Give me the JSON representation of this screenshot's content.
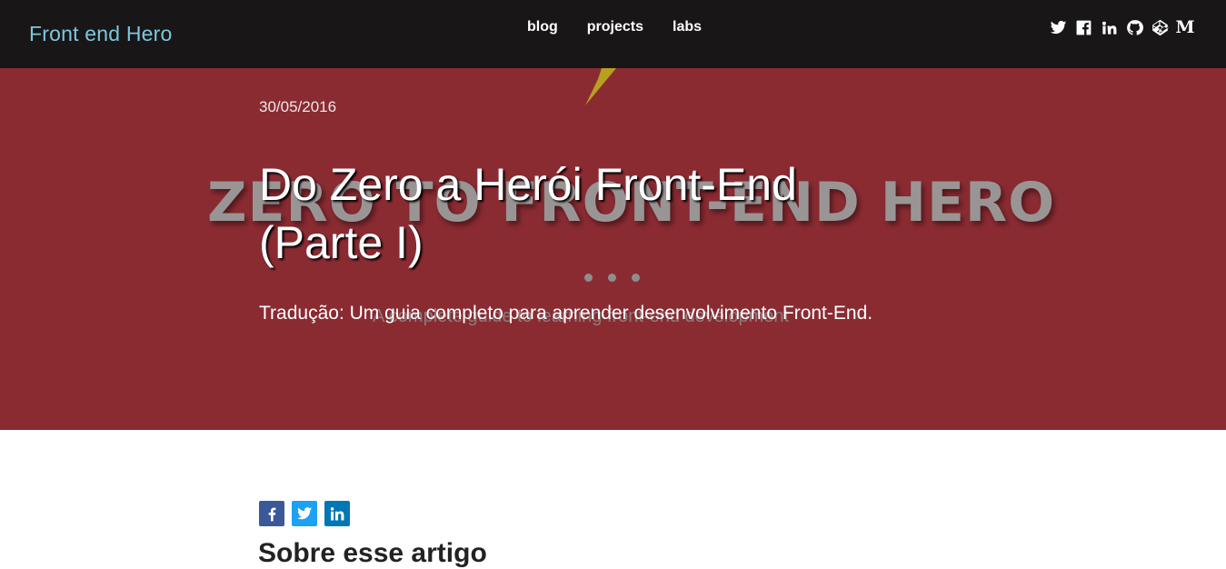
{
  "site": {
    "brand": "Front end Hero"
  },
  "nav": {
    "items": [
      {
        "label": "blog"
      },
      {
        "label": "projects"
      },
      {
        "label": "labs"
      }
    ]
  },
  "social": {
    "icons": [
      "twitter-icon",
      "facebook-icon",
      "linkedin-icon",
      "github-icon",
      "codepen-icon",
      "medium-icon"
    ],
    "medium_letter": "M"
  },
  "hero": {
    "background_color": "#8a2b32",
    "image_text": "ZERO TO FRONT-END HERO",
    "image_subtext": "A complete guide to learning front-end development",
    "date": "30/05/2016",
    "title": "Do Zero a Herói Front-End (Parte I)",
    "subtitle": "Tradução: Um guia completo para aprender desenvolvimento Front-End."
  },
  "share": {
    "buttons": [
      {
        "name": "facebook",
        "color": "#3b5998"
      },
      {
        "name": "twitter",
        "color": "#1da1f2"
      },
      {
        "name": "linkedin",
        "color": "#0077b5"
      }
    ]
  },
  "content": {
    "section_heading": "Sobre esse artigo"
  }
}
